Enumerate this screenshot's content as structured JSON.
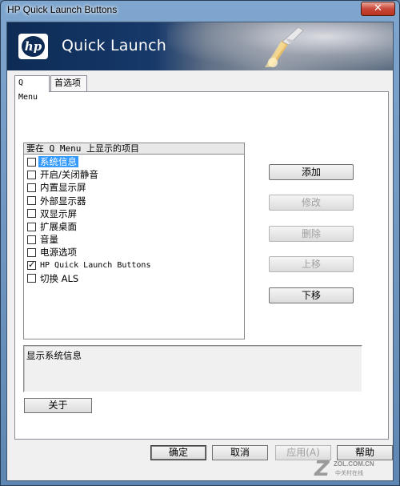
{
  "window": {
    "title": "HP Quick Launch Buttons",
    "close_label": "✕"
  },
  "banner": {
    "logo_text": "hp",
    "title": "Quick Launch"
  },
  "tabs": [
    {
      "label": "Q Menu",
      "active": true
    },
    {
      "label": "首选项",
      "active": false
    }
  ],
  "list": {
    "header": "要在 Q Menu 上显示的项目",
    "items": [
      {
        "label": "系统信息",
        "checked": false,
        "selected": true
      },
      {
        "label": "开启/关闭静音",
        "checked": false,
        "selected": false
      },
      {
        "label": "内置显示屏",
        "checked": false,
        "selected": false
      },
      {
        "label": "外部显示器",
        "checked": false,
        "selected": false
      },
      {
        "label": "双显示屏",
        "checked": false,
        "selected": false
      },
      {
        "label": "扩展桌面",
        "checked": false,
        "selected": false
      },
      {
        "label": "音量",
        "checked": false,
        "selected": false
      },
      {
        "label": "电源选项",
        "checked": false,
        "selected": false
      },
      {
        "label": "HP Quick Launch Buttons",
        "checked": true,
        "selected": false
      },
      {
        "label": "切换 ALS",
        "checked": false,
        "selected": false
      }
    ]
  },
  "side_buttons": {
    "add": "添加",
    "modify": "修改",
    "delete": "删除",
    "move_up": "上移",
    "move_down": "下移"
  },
  "description": "显示系统信息",
  "about_button": "关于",
  "bottom_buttons": {
    "ok": "确定",
    "cancel": "取消",
    "apply": "应用(A)",
    "help": "帮助"
  },
  "watermark": {
    "logo": "Z",
    "site": "ZOL.COM.CN",
    "subtitle": "中关村在线"
  }
}
